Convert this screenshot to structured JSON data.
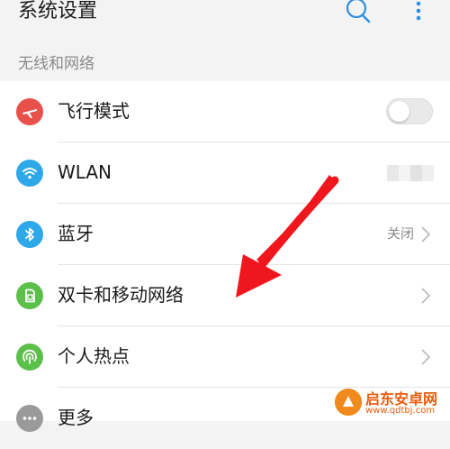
{
  "header": {
    "title": "系统设置",
    "search_icon": "search-icon",
    "more_icon": "more-vert-icon"
  },
  "section": {
    "label": "无线和网络"
  },
  "rows": [
    {
      "label": "飞行模式",
      "icon": "airplane-icon",
      "icon_color": "#e8514a",
      "control": "toggle",
      "toggle_on": false
    },
    {
      "label": "WLAN",
      "icon": "wifi-icon",
      "icon_color": "#2ea8e8",
      "control": "redacted"
    },
    {
      "label": "蓝牙",
      "icon": "bluetooth-icon",
      "icon_color": "#2ea8e8",
      "value": "关闭",
      "control": "chevron"
    },
    {
      "label": "双卡和移动网络",
      "icon": "sim-card-icon",
      "icon_color": "#5bbf4a",
      "control": "chevron"
    },
    {
      "label": "个人热点",
      "icon": "hotspot-icon",
      "icon_color": "#5bbf4a",
      "control": "chevron"
    },
    {
      "label": "更多",
      "icon": "more-icon",
      "icon_color": "#9a9a9a"
    }
  ],
  "watermark": {
    "name": "启东安卓网",
    "url": "www.qdtbj.com"
  },
  "colors": {
    "annotation_arrow": "#f0161d",
    "background": "#f3f3f3"
  }
}
